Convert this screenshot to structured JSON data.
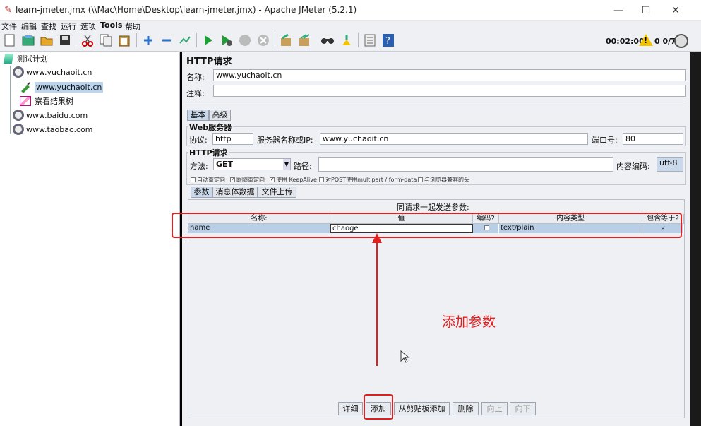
{
  "window": {
    "title": "learn-jmeter.jmx (\\\\Mac\\Home\\Desktop\\learn-jmeter.jmx) - Apache JMeter (5.2.1)",
    "minimize": "—",
    "maximize": "☐",
    "close": "✕"
  },
  "menu": [
    "文件",
    "编辑",
    "查找",
    "运行",
    "选项",
    "Tools",
    "帮助"
  ],
  "toolbar": {
    "timer": "00:02:00",
    "warning_mark": "!",
    "threads": "0 0/7",
    "icons": [
      "new-icon",
      "templates-icon",
      "open-icon",
      "save-icon",
      "cut-icon",
      "copy-icon",
      "paste-icon",
      "expand-icon",
      "collapse-icon",
      "toggle-icon",
      "start-icon",
      "start-no-pause-icon",
      "stop-icon",
      "shutdown-icon",
      "clear-icon",
      "clear-all-icon",
      "search-icon",
      "reset-search-icon",
      "function-helper-icon",
      "help-icon"
    ]
  },
  "tree": {
    "test_plan": "测试计划",
    "thread_group_1": "www.yuchaoit.cn",
    "sampler_selected": "www.yuchaoit.cn",
    "listener": "察看结果树",
    "thread_group_2": "www.baidu.com",
    "thread_group_3": "www.taobao.com"
  },
  "panel": {
    "heading": "HTTP请求",
    "name_label": "名称:",
    "name_value": "www.yuchaoit.cn",
    "comment_label": "注释:",
    "comment_value": "",
    "tabs": [
      "基本",
      "高级"
    ],
    "web_server": {
      "title": "Web服务器",
      "protocol_label": "协议:",
      "protocol_value": "http",
      "server_label": "服务器名称或IP:",
      "server_value": "www.yuchaoit.cn",
      "port_label": "端口号:",
      "port_value": "80"
    },
    "http_request": {
      "title": "HTTP请求",
      "method_label": "方法:",
      "method_value": "GET",
      "path_label": "路径:",
      "path_value": "",
      "encoding_label": "内容编码:",
      "encoding_value": "utf-8"
    },
    "options": [
      {
        "label": "自动重定向",
        "checked": false
      },
      {
        "label": "跟随重定向",
        "checked": true
      },
      {
        "label": "使用 KeepAlive",
        "checked": true
      },
      {
        "label": "对POST使用multipart / form-data",
        "checked": false
      },
      {
        "label": "与浏览器兼容的头",
        "checked": false
      }
    ],
    "sub_tabs": [
      "参数",
      "消息体数据",
      "文件上传"
    ],
    "params_caption": "同请求一起发送参数:",
    "columns": [
      "名称:",
      "值",
      "编码?",
      "内容类型",
      "包含等于?"
    ],
    "rows": [
      {
        "name": "name",
        "value": "chaoge",
        "encode": false,
        "content_type": "text/plain",
        "include_equals": true
      }
    ],
    "buttons": [
      "详细",
      "添加",
      "从剪贴板添加",
      "删除",
      "向上",
      "向下"
    ]
  },
  "annotation": {
    "text": "添加参数",
    "color": "#e02020"
  }
}
